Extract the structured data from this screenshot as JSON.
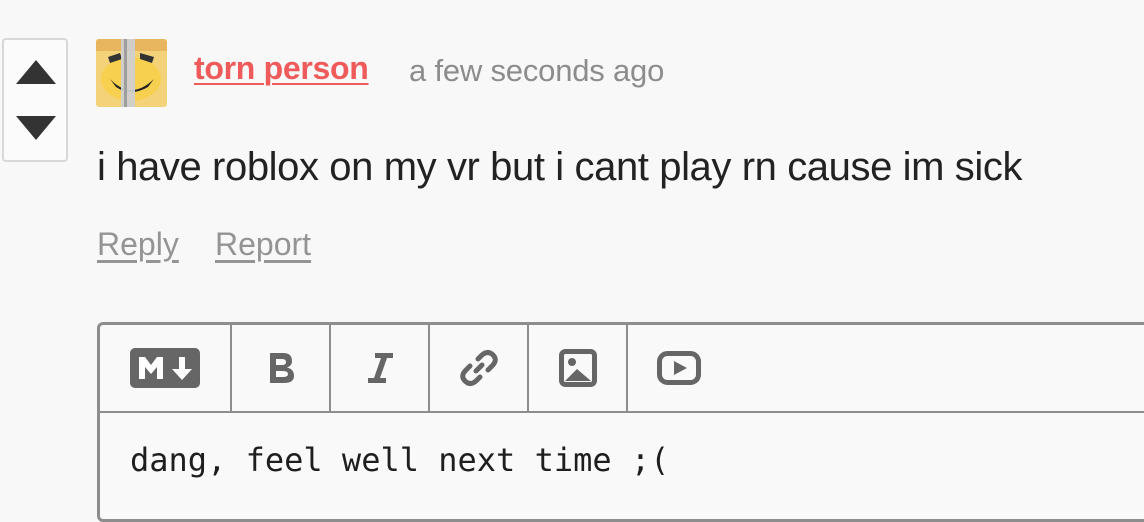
{
  "comment": {
    "author": "torn person",
    "timestamp": "a few seconds ago",
    "text": "i have roblox on my vr but i cant play rn cause im sick",
    "actions": {
      "reply": "Reply",
      "report": "Report"
    }
  },
  "votes": {
    "up_icon": "triangle-up-icon",
    "down_icon": "triangle-down-icon"
  },
  "editor": {
    "toolbar": [
      "markdown-icon",
      "bold-icon",
      "italic-icon",
      "link-icon",
      "image-icon",
      "video-icon"
    ],
    "value": "dang, feel well next time ;("
  },
  "colors": {
    "author": "#ef5a5a",
    "muted": "#8c8c8c",
    "border": "#8d8d8d",
    "icon": "#666666"
  }
}
